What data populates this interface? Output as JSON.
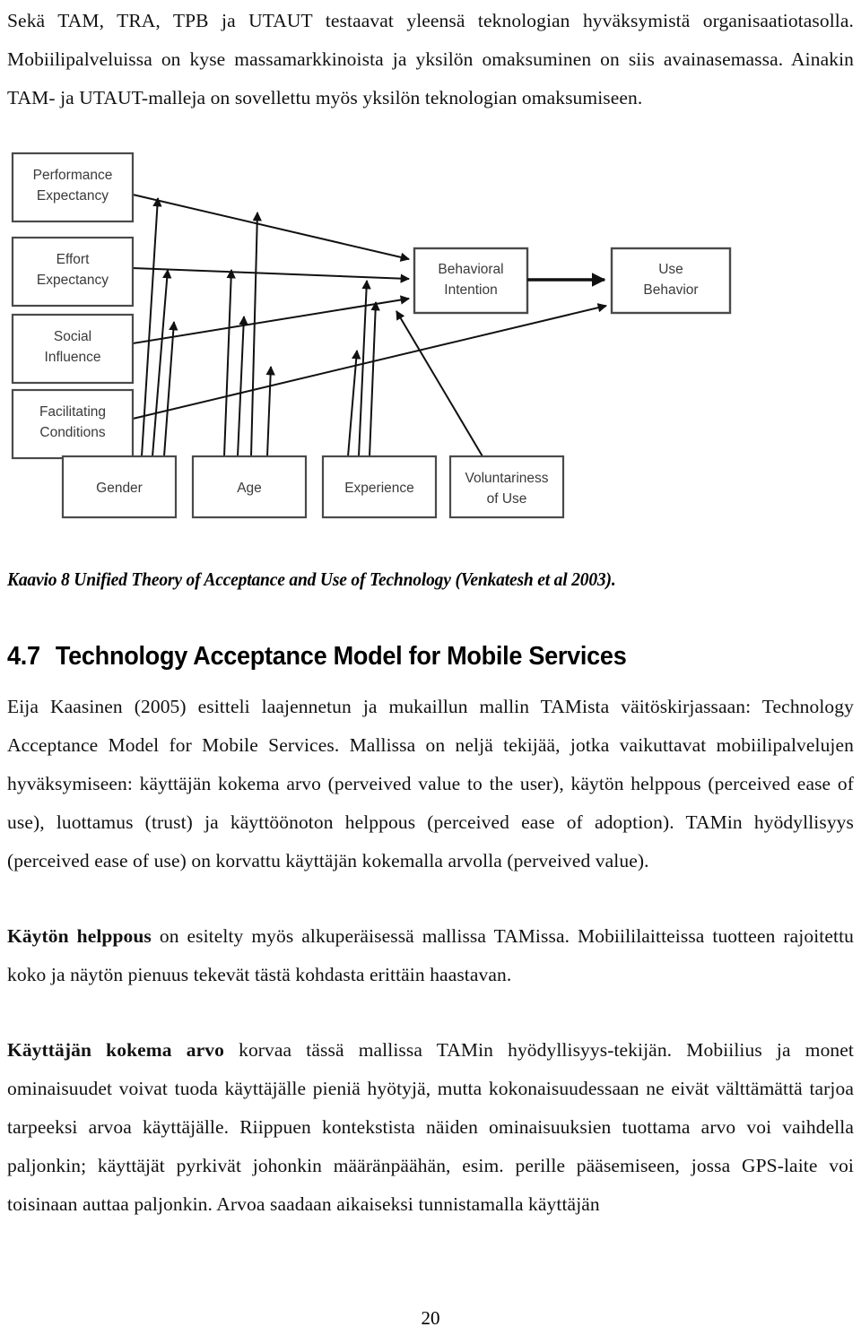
{
  "document": {
    "page_number": "20"
  },
  "intro": {
    "paragraphs": [
      "Sekä TAM, TRA, TPB ja UTAUT testaavat yleensä teknologian hyväksymistä organisaatiotasolla. Mobiilipalveluissa on kyse massamarkkinoista ja yksilön omaksuminen on siis avainasemassa. Ainakin TAM- ja UTAUT-malleja on sovellettu myös yksilön teknologian omaksumiseen."
    ]
  },
  "figure": {
    "caption": "Kaavio 8 Unified Theory of Acceptance and Use of Technology (Venkatesh et al 2003).",
    "determinants": [
      {
        "id": "performance-expectancy",
        "line1": "Performance",
        "line2": "Expectancy"
      },
      {
        "id": "effort-expectancy",
        "line1": "Effort",
        "line2": "Expectancy"
      },
      {
        "id": "social-influence",
        "line1": "Social",
        "line2": "Influence"
      },
      {
        "id": "facilitating-conditions",
        "line1": "Facilitating",
        "line2": "Conditions"
      }
    ],
    "outcomes": [
      {
        "id": "behavioral-intention",
        "line1": "Behavioral",
        "line2": "Intention"
      },
      {
        "id": "use-behavior",
        "line1": "Use",
        "line2": "Behavior"
      }
    ],
    "moderators": [
      {
        "id": "gender",
        "line1": "Gender",
        "line2": ""
      },
      {
        "id": "age",
        "line1": "Age",
        "line2": ""
      },
      {
        "id": "experience",
        "line1": "Experience",
        "line2": ""
      },
      {
        "id": "voluntariness-of-use",
        "line1": "Voluntariness",
        "line2": "of Use"
      }
    ]
  },
  "section": {
    "number": "4.7",
    "title": "Technology Acceptance Model for Mobile Services"
  },
  "body": {
    "p1": "Eija Kaasinen (2005) esitteli laajennetun ja mukaillun mallin TAMista väitöskirjassaan: Technology Acceptance Model for Mobile Services. Mallissa on neljä tekijää, jotka vaikuttavat mobiilipalvelujen hyväksymiseen: käyttäjän kokema arvo (perveived value to the user), käytön helppous (perceived ease of use), luottamus (trust) ja käyttöönoton helppous (perceived ease of adoption). TAMin hyödyllisyys (perceived ease of use) on korvattu käyttäjän kokemalla arvolla (perveived value).",
    "p2_bold": "Käytön helppous",
    "p2_rest": " on esitelty myös alkuperäisessä mallissa TAMissa. Mobiililaitteissa tuotteen rajoitettu koko ja näytön pienuus tekevät tästä kohdasta erittäin haastavan.",
    "p3_bold": "Käyttäjän kokema arvo",
    "p3_rest": " korvaa tässä mallissa TAMin hyödyllisyys-tekijän. Mobiilius ja monet ominaisuudet voivat tuoda käyttäjälle pieniä hyötyjä, mutta kokonaisuudessaan ne eivät välttämättä tarjoa tarpeeksi arvoa käyttäjälle. Riippuen kontekstista näiden ominaisuuksien tuottama arvo voi vaihdella paljonkin; käyttäjät pyrkivät johonkin määränpäähän, esim. perille pääsemiseen, jossa GPS-laite voi toisinaan auttaa paljonkin. Arvoa saadaan aikaiseksi tunnistamalla käyttäjän"
  }
}
